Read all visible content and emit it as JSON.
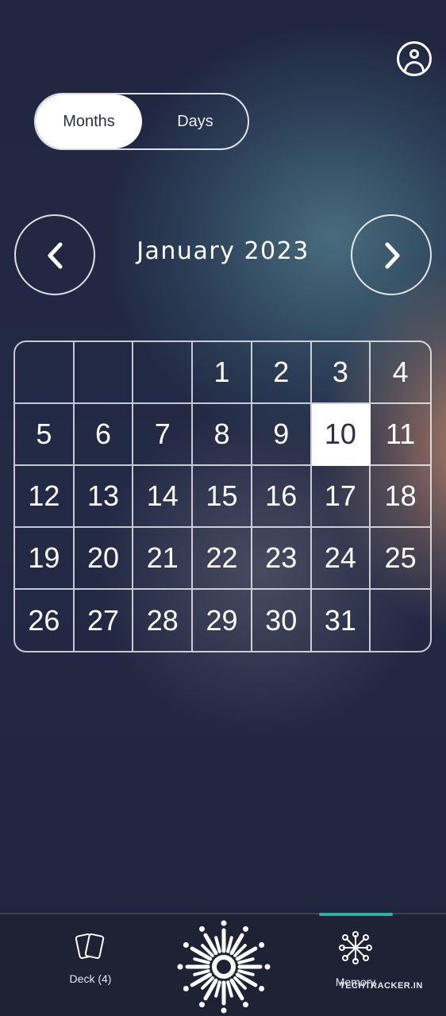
{
  "header": {
    "profile_icon": "user-circle-icon"
  },
  "view_toggle": {
    "options": [
      "Months",
      "Days"
    ],
    "selected": "Months"
  },
  "calendar": {
    "month_title": "January 2023",
    "prev_icon": "chevron-left-icon",
    "next_icon": "chevron-right-icon",
    "selected_day": "10",
    "weeks": [
      [
        "",
        "",
        "",
        "1",
        "2",
        "3",
        "4"
      ],
      [
        "5",
        "6",
        "7",
        "8",
        "9",
        "10",
        "11"
      ],
      [
        "12",
        "13",
        "14",
        "15",
        "16",
        "17",
        "18"
      ],
      [
        "19",
        "20",
        "21",
        "22",
        "23",
        "24",
        "25"
      ],
      [
        "26",
        "27",
        "28",
        "29",
        "30",
        "31",
        ""
      ]
    ]
  },
  "tabbar": {
    "deck": {
      "label": "Deck (4)",
      "icon": "cards-icon"
    },
    "center": {
      "icon": "sun-burst-icon"
    },
    "memory": {
      "label": "Memory",
      "icon": "network-node-icon",
      "active": true
    },
    "watermark": "TECHTRACKER.IN",
    "accent_color": "#2fb3a0"
  }
}
